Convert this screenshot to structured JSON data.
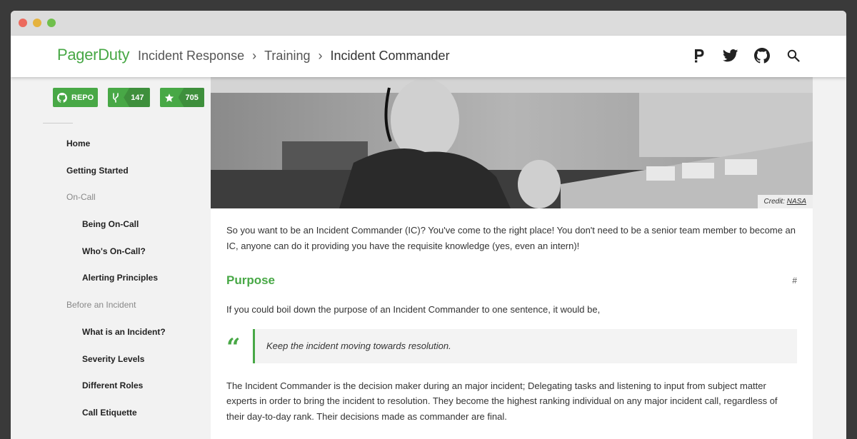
{
  "header": {
    "brand": "PagerDuty",
    "breadcrumbs": [
      "Incident Response",
      "Training",
      "Incident Commander"
    ],
    "icons": [
      "pagerduty-icon",
      "twitter-icon",
      "github-icon",
      "search-icon"
    ]
  },
  "sidebar": {
    "badges": {
      "repo_label": "REPO",
      "forks": "147",
      "stars": "705"
    },
    "nav": [
      {
        "label": "Home",
        "level": "l1"
      },
      {
        "label": "Getting Started",
        "level": "l1"
      },
      {
        "label": "On-Call",
        "level": "section"
      },
      {
        "label": "Being On-Call",
        "level": "l2"
      },
      {
        "label": "Who's On-Call?",
        "level": "l2"
      },
      {
        "label": "Alerting Principles",
        "level": "l2"
      },
      {
        "label": "Before an Incident",
        "level": "section"
      },
      {
        "label": "What is an Incident?",
        "level": "l2"
      },
      {
        "label": "Severity Levels",
        "level": "l2"
      },
      {
        "label": "Different Roles",
        "level": "l2"
      },
      {
        "label": "Call Etiquette",
        "level": "l2"
      }
    ]
  },
  "content": {
    "hero_credit_prefix": "Credit: ",
    "hero_credit_link": "NASA",
    "intro": "So you want to be an Incident Commander (IC)? You've come to the right place! You don't need to be a senior team member to become an IC, anyone can do it providing you have the requisite knowledge (yes, even an intern)!",
    "heading": "Purpose",
    "anchor": "#",
    "purpose_text": "If you could boil down the purpose of an Incident Commander to one sentence, it would be,",
    "quote": "Keep the incident moving towards resolution.",
    "paragraph": "The Incident Commander is the decision maker during an major incident; Delegating tasks and listening to input from subject matter experts in order to bring the incident to resolution. They become the highest ranking individual on any major incident call, regardless of their day-to-day rank. Their decisions made as commander are final."
  },
  "colors": {
    "accent": "#48a846",
    "accent_dark": "#3e8f3c",
    "window_chrome": "#dcdcdc"
  }
}
